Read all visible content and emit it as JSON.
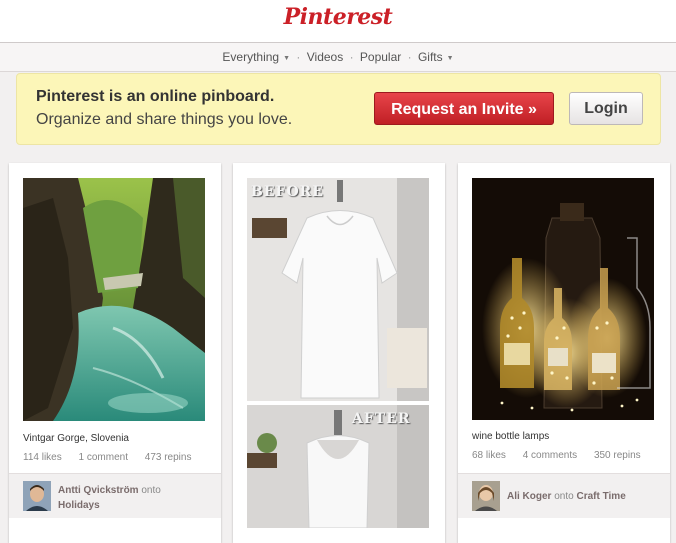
{
  "header": {
    "logo": "Pinterest"
  },
  "nav": {
    "items": [
      {
        "label": "Everything",
        "has_caret": true
      },
      {
        "label": "Videos",
        "has_caret": false
      },
      {
        "label": "Popular",
        "has_caret": false
      },
      {
        "label": "Gifts",
        "has_caret": true
      }
    ],
    "caret": "▼",
    "separator": "·"
  },
  "banner": {
    "headline": "Pinterest is an online pinboard.",
    "subline": "Organize and share things you love.",
    "invite_label": "Request an Invite »",
    "login_label": "Login"
  },
  "pins": [
    {
      "description": "Vintgar Gorge, Slovenia",
      "likes": "114 likes",
      "comments": "1 comment",
      "repins": "473 repins",
      "user": "Antti Qvickström",
      "onto": "onto",
      "board": "Holidays"
    },
    {
      "before_label": "BEFORE",
      "after_label": "AFTER"
    },
    {
      "description": "wine bottle lamps",
      "likes": "68 likes",
      "comments": "4 comments",
      "repins": "350 repins",
      "user": "Ali Koger",
      "onto": "onto",
      "board": "Craft Time"
    }
  ],
  "colors": {
    "brand": "#cb2027",
    "banner_bg": "#fcf6b8",
    "invite_button": "#d32a30"
  }
}
